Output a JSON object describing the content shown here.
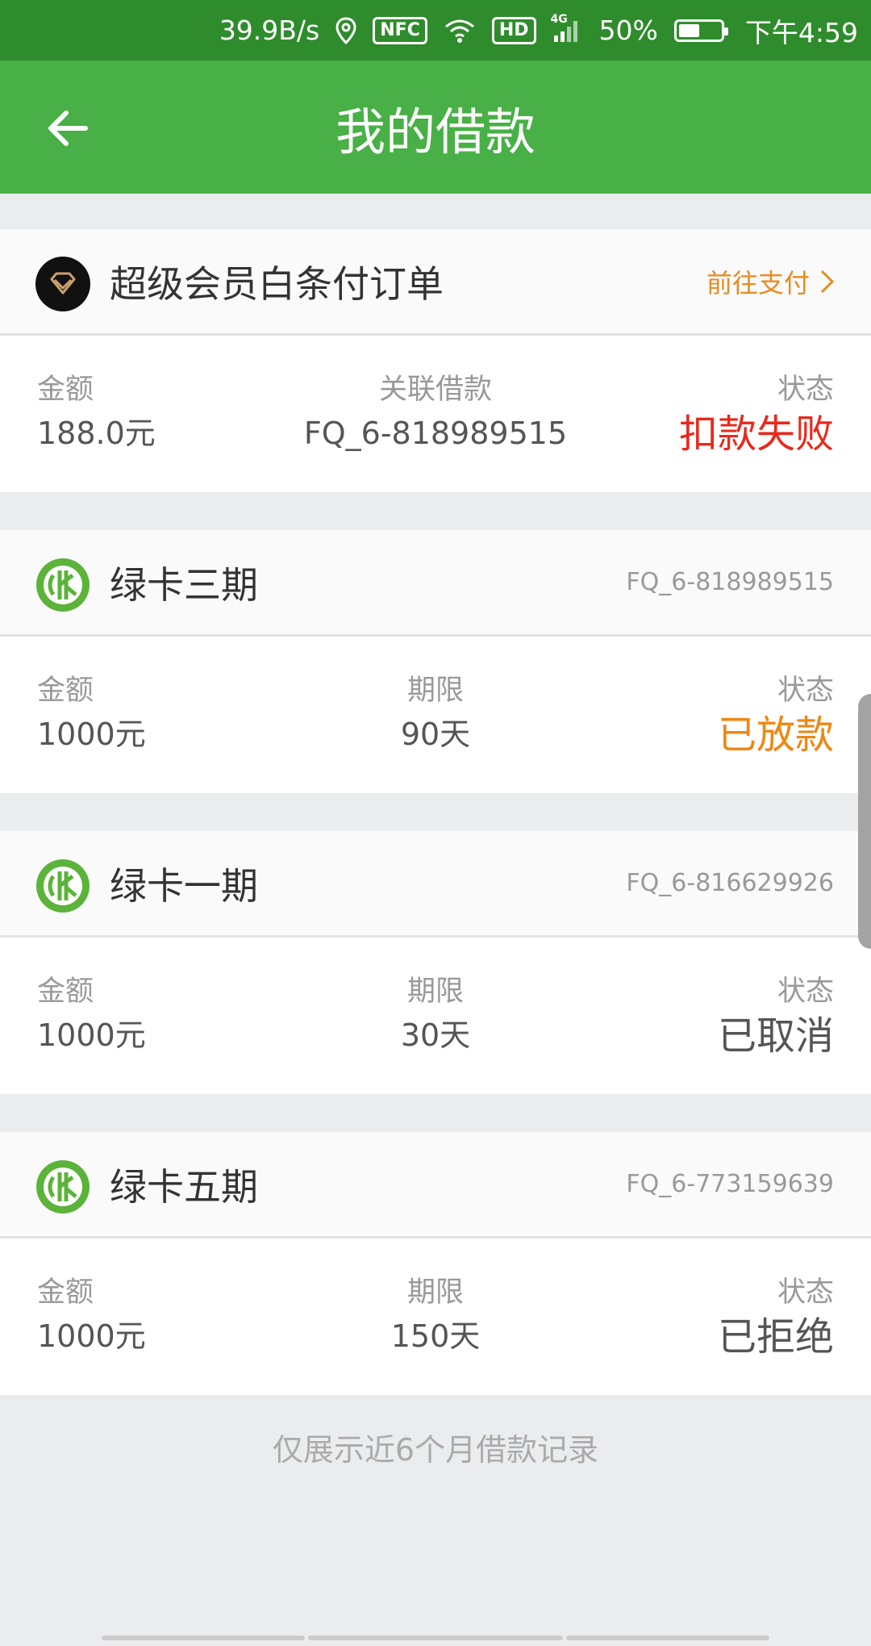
{
  "status_bar": {
    "speed": "39.9B/s",
    "nfc": "NFC",
    "hd": "HD",
    "network": "4G",
    "battery": "50%",
    "battery_level": 0.5,
    "time": "下午4:59",
    "icons": [
      "location-icon",
      "wifi-icon",
      "signal-icon",
      "battery-icon"
    ]
  },
  "header": {
    "title": "我的借款",
    "back_icon": "arrow-left-icon",
    "background_color": "#48b046"
  },
  "cards": [
    {
      "type": "member",
      "title": "超级会员白条付订单",
      "icon": "diamond-icon",
      "action_label": "前往支付",
      "columns": [
        {
          "label": "金额",
          "value": "188.0元"
        },
        {
          "label": "关联借款",
          "value": "FQ_6-818989515"
        },
        {
          "label": "状态",
          "value": "扣款失败",
          "color": "#e8291c"
        }
      ]
    },
    {
      "type": "loan",
      "title": "绿卡三期",
      "icon": "greencard-logo-icon",
      "loan_id": "FQ_6-818989515",
      "columns": [
        {
          "label": "金额",
          "value": "1000元"
        },
        {
          "label": "期限",
          "value": "90天"
        },
        {
          "label": "状态",
          "value": "已放款",
          "color": "#ef8712"
        }
      ]
    },
    {
      "type": "loan",
      "title": "绿卡一期",
      "icon": "greencard-logo-icon",
      "loan_id": "FQ_6-816629926",
      "columns": [
        {
          "label": "金额",
          "value": "1000元"
        },
        {
          "label": "期限",
          "value": "30天"
        },
        {
          "label": "状态",
          "value": "已取消",
          "color": "#555555"
        }
      ]
    },
    {
      "type": "loan",
      "title": "绿卡五期",
      "icon": "greencard-logo-icon",
      "loan_id": "FQ_6-773159639",
      "columns": [
        {
          "label": "金额",
          "value": "1000元"
        },
        {
          "label": "期限",
          "value": "150天"
        },
        {
          "label": "状态",
          "value": "已拒绝",
          "color": "#555555"
        }
      ]
    }
  ],
  "footer_note": "仅展示近6个月借款记录"
}
